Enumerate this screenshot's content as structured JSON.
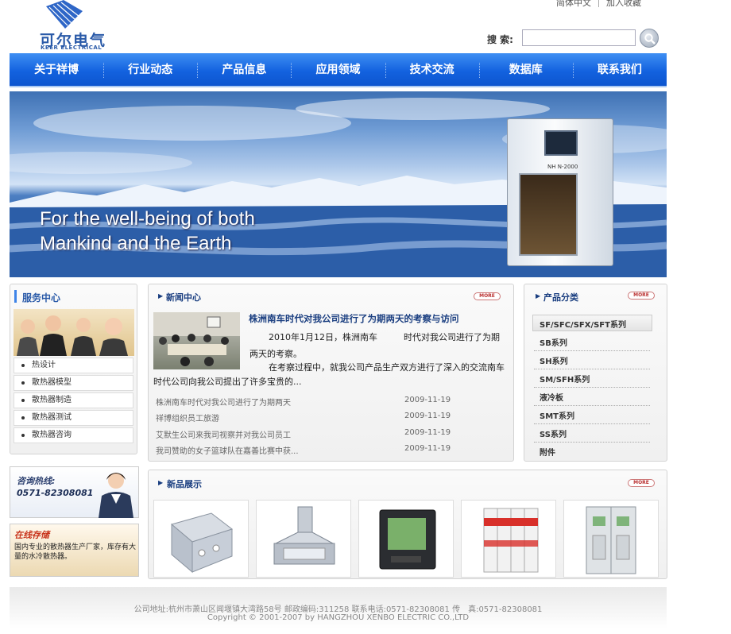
{
  "header": {
    "logo_cn": "可尔电气",
    "logo_en": "KEER ELECTRICAL",
    "top_links": [
      "简体中文",
      "加入收藏"
    ],
    "search_label": "搜 索:",
    "search_value": "",
    "colors": {
      "nav": "#1362df",
      "brand": "#2a5aa8"
    }
  },
  "nav": [
    "关于祥博",
    "行业动态",
    "产品信息",
    "应用领域",
    "技术交流",
    "数据库",
    "联系我们"
  ],
  "banner": {
    "line1": "For the well-being of both",
    "line2": "Mankind  and the Earth",
    "device_label": "NH N-2000"
  },
  "service": {
    "title": "服务中心",
    "items": [
      "热设计",
      "散热器模型",
      "散热器制造",
      "散热器测试",
      "散热器咨询"
    ]
  },
  "hotline": {
    "title": "咨询热线:",
    "phone": "0571-82308081"
  },
  "stock": {
    "title": "在线存储",
    "text": "国内专业的散热器生产厂家，库存有大量的水冷散热器。"
  },
  "news": {
    "title": "新闻中心",
    "more": "MORE",
    "headline": "株洲南车时代对我公司进行了为期两天的考察与访问",
    "para1": "2010年1月12日，株洲南车　　　时代对我公司进行了为期两天的考察。",
    "para2": "在考察过程中，就我公司产品生产双方进行了深入的交流南车时代公司向我公司提出了许多宝贵的...",
    "items": [
      {
        "title": "株洲南车时代对我公司进行了为期两天",
        "date": "2009-11-19"
      },
      {
        "title": "祥博组织员工旅游",
        "date": "2009-11-19"
      },
      {
        "title": "艾默生公司来我司视察并对我公司员工",
        "date": "2009-11-19"
      },
      {
        "title": "我司赞助的女子篮球队在嘉善比赛中获...",
        "date": "2009-11-19"
      }
    ]
  },
  "categories": {
    "title": "产品分类",
    "more": "MORE",
    "items": [
      "SF/SFC/SFX/SFT系列",
      "SB系列",
      "SH系列",
      "SM/SFH系列",
      "液冷板",
      "SMT系列",
      "SS系列",
      "附件"
    ]
  },
  "products": {
    "title": "新品展示",
    "more": "MORE"
  },
  "footer": {
    "line1": "公司地址:杭州市萧山区闻堰镇大湾路58号 邮政编码:311258 联系电话:0571-82308081 传　真:0571-82308081",
    "line2": "Copyright © 2001-2007 by HANGZHOU XENBO ELECTRIC CO.,LTD"
  }
}
